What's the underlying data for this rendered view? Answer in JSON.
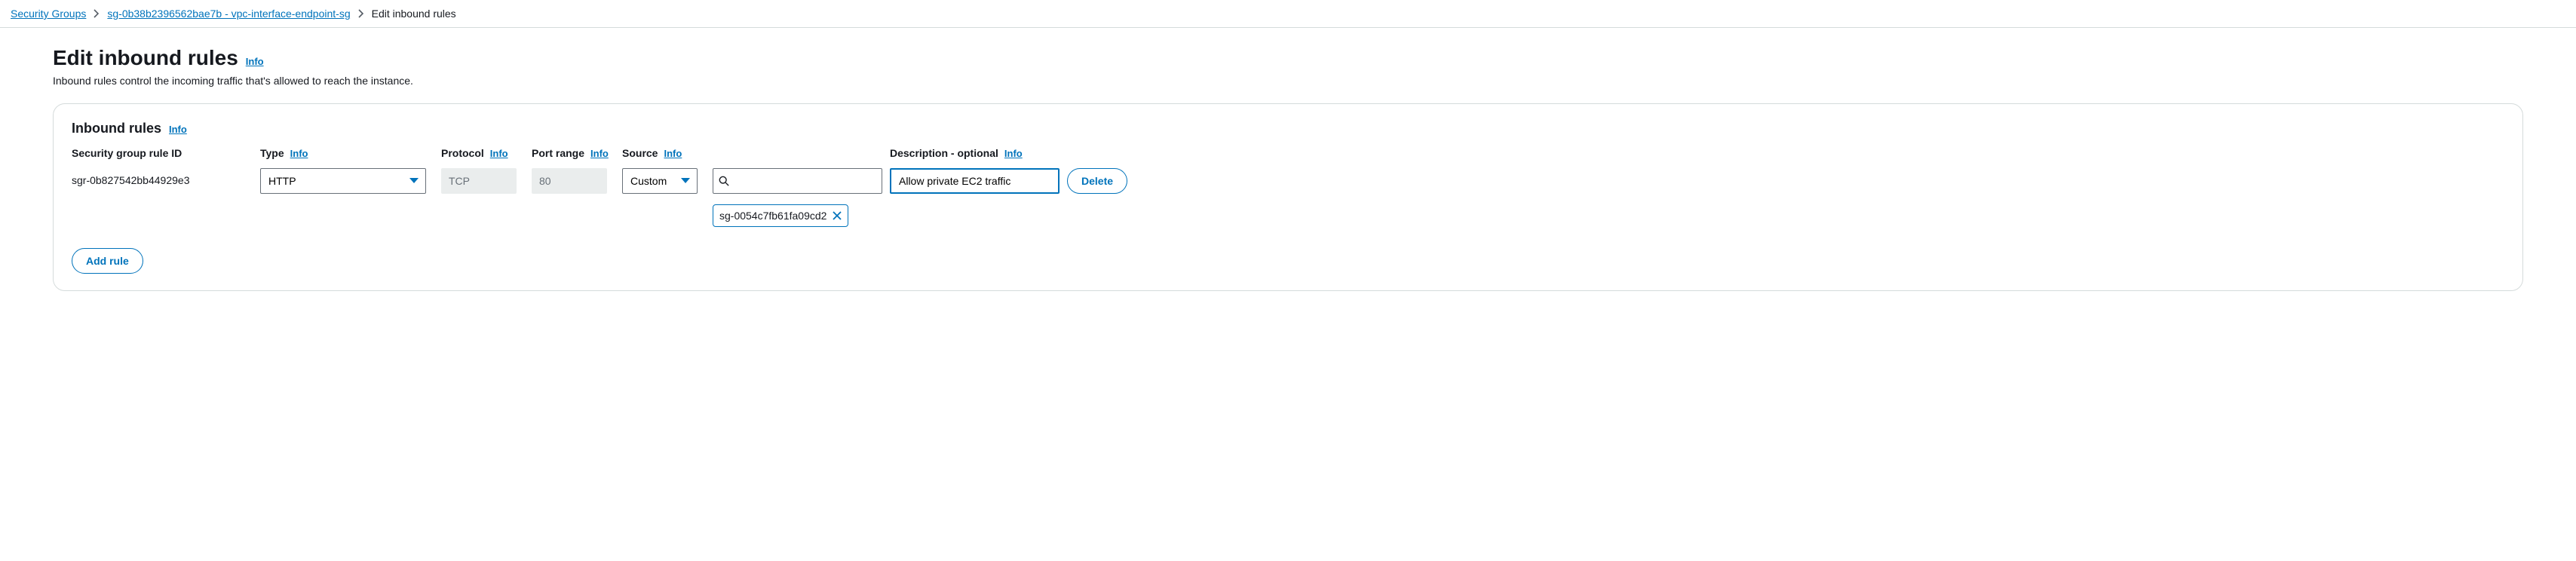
{
  "breadcrumb": {
    "root": "Security Groups",
    "sg": "sg-0b38b2396562bae7b - vpc-interface-endpoint-sg",
    "current": "Edit inbound rules"
  },
  "page": {
    "title": "Edit inbound rules",
    "info": "Info",
    "subtitle": "Inbound rules control the incoming traffic that's allowed to reach the instance."
  },
  "panel": {
    "title": "Inbound rules",
    "info": "Info",
    "headers": {
      "ruleid": "Security group rule ID",
      "type": "Type",
      "protocol": "Protocol",
      "portrange": "Port range",
      "source": "Source",
      "description": "Description - optional"
    },
    "rule": {
      "id": "sgr-0b827542bb44929e3",
      "type": "HTTP",
      "protocol": "TCP",
      "portrange": "80",
      "sourceMode": "Custom",
      "sourceSearch": "",
      "sourceToken": "sg-0054c7fb61fa09cd2",
      "description": "Allow private EC2 traffic"
    },
    "deleteLabel": "Delete",
    "addRuleLabel": "Add rule"
  }
}
